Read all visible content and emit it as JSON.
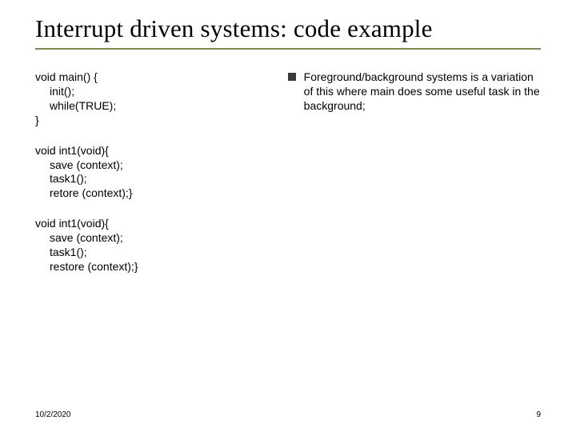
{
  "title": "Interrupt driven systems: code example",
  "code": {
    "block1": {
      "l1": "void main() {",
      "l2": "init();",
      "l3": "while(TRUE);",
      "l4": "}"
    },
    "block2": {
      "l1": "void int1(void){",
      "l2": "save (context);",
      "l3": "task1();",
      "l4": "retore (context);}"
    },
    "block3": {
      "l1": "void int1(void){",
      "l2": "save (context);",
      "l3": "task1();",
      "l4": "restore (context);}"
    }
  },
  "bullet": {
    "text": "Foreground/background systems is a variation of this where main does some useful task in the background;"
  },
  "footer": {
    "date": "10/2/2020",
    "page": "9"
  }
}
